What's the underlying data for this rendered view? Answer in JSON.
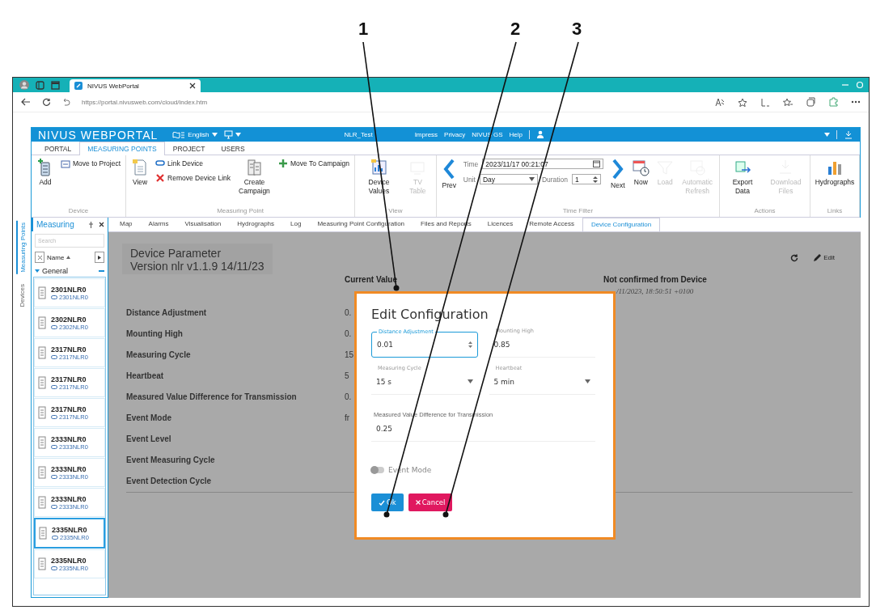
{
  "callouts": [
    "1",
    "2",
    "3"
  ],
  "browser": {
    "tab_title": "NIVUS WebPortal",
    "url": "https://portal.nivusweb.com/cloud/index.htm"
  },
  "header": {
    "brand": "NIVUS WEBPORTAL",
    "language": "English",
    "project": "NLR_Test",
    "links": [
      "Impress",
      "Privacy",
      "NIVUS GS",
      "Help"
    ]
  },
  "ribbon": {
    "tabs": [
      {
        "label": "PORTAL",
        "selected": false
      },
      {
        "label": "MEASURING POINTS",
        "selected": true
      },
      {
        "label": "PROJECT",
        "selected": false
      },
      {
        "label": "USERS",
        "selected": false
      }
    ],
    "groups": [
      {
        "title": "Device",
        "columns": [
          [
            {
              "kind": "large",
              "label": "Add",
              "disabled": false
            }
          ],
          [
            {
              "kind": "small",
              "label": "Move to Project",
              "disabled": false
            }
          ]
        ]
      },
      {
        "title": "Measuring Point",
        "columns": [
          [
            {
              "kind": "large",
              "label": "View",
              "disabled": false
            }
          ],
          [
            {
              "kind": "small",
              "label": "Link Device",
              "disabled": false
            },
            {
              "kind": "small",
              "label": "Remove Device Link",
              "disabled": false
            }
          ],
          [
            {
              "kind": "large",
              "label": "Create Campaign",
              "disabled": false
            }
          ],
          [
            {
              "kind": "small",
              "label": "Move To Campaign",
              "disabled": false
            }
          ]
        ]
      },
      {
        "title": "View",
        "columns": [
          [
            {
              "kind": "large",
              "label": "Device Values",
              "disabled": false
            }
          ],
          [
            {
              "kind": "large",
              "label": "TV Table",
              "disabled": true
            }
          ]
        ]
      },
      {
        "title": "Time Filter",
        "columns": [
          [
            {
              "kind": "nav",
              "label": "Prev",
              "disabled": false
            }
          ],
          [
            {
              "kind": "fields",
              "fields": [
                {
                  "kind": "date",
                  "label": "Time",
                  "value": "2023/11/17 00:21:07"
                }
              ]
            },
            {
              "kind": "fields",
              "fields": [
                {
                  "kind": "select",
                  "label": "Unit",
                  "value": "Day"
                },
                {
                  "kind": "spin",
                  "label": "Duration",
                  "value": "1"
                }
              ]
            }
          ],
          [
            {
              "kind": "nav",
              "label": "Next",
              "disabled": false
            }
          ],
          [
            {
              "kind": "large",
              "label": "Now",
              "disabled": false
            }
          ],
          [
            {
              "kind": "large",
              "label": "Load",
              "disabled": true
            }
          ],
          [
            {
              "kind": "large",
              "label": "Automatic Refresh",
              "disabled": true
            }
          ]
        ]
      },
      {
        "title": "Actions",
        "columns": [
          [
            {
              "kind": "large",
              "label": "Export Data",
              "disabled": false
            }
          ],
          [
            {
              "kind": "large",
              "label": "Download Files",
              "disabled": true
            }
          ]
        ]
      },
      {
        "title": "Links",
        "columns": [
          [
            {
              "kind": "large",
              "label": "Hydrographs",
              "disabled": false
            }
          ]
        ]
      }
    ]
  },
  "sidebar": {
    "vertical_tabs": [
      {
        "label": "Measuring Points",
        "selected": true
      },
      {
        "label": "Devices",
        "selected": false
      }
    ],
    "title": "Measuring",
    "search": {
      "placeholder": "Search"
    },
    "sort": "Name",
    "group": {
      "label": "General",
      "expanded": true,
      "items": [
        {
          "name": "2301NLR0",
          "sub": "2301NLR0",
          "selected": false
        },
        {
          "name": "2302NLR0",
          "sub": "2302NLR0",
          "selected": false
        },
        {
          "name": "2317NLR0",
          "sub": "2317NLR0",
          "selected": false
        },
        {
          "name": "2317NLR0",
          "sub": "2317NLR0",
          "selected": false
        },
        {
          "name": "2317NLR0",
          "sub": "2317NLR0",
          "selected": false
        },
        {
          "name": "2333NLR0",
          "sub": "2333NLR0",
          "selected": false
        },
        {
          "name": "2333NLR0",
          "sub": "2333NLR0",
          "selected": false
        },
        {
          "name": "2333NLR0",
          "sub": "2333NLR0",
          "selected": false
        },
        {
          "name": "2335NLR0",
          "sub": "2335NLR0",
          "selected": true
        },
        {
          "name": "2335NLR0",
          "sub": "2335NLR0",
          "selected": false
        }
      ]
    }
  },
  "doc_tabs": [
    {
      "label": "Map",
      "selected": false
    },
    {
      "label": "Alarms",
      "selected": false
    },
    {
      "label": "Visualisation",
      "selected": false
    },
    {
      "label": "Hydrographs",
      "selected": false
    },
    {
      "label": "Log",
      "selected": false
    },
    {
      "label": "Measuring Point Configuration",
      "selected": false
    },
    {
      "label": "Files and Reports",
      "selected": false
    },
    {
      "label": "Licences",
      "selected": false
    },
    {
      "label": "Remote Access",
      "selected": false
    },
    {
      "label": "Device Configuration",
      "selected": true
    }
  ],
  "device": {
    "title": "Device Parameter",
    "version": "Version nlr v1.1.9 14/11/23",
    "edit": "Edit",
    "columns": [
      "Current Value",
      "Not confirmed from Device"
    ],
    "timestamp": "/11/2023, 18:50:51 +0100",
    "parameters": [
      {
        "label": "Distance Adjustment",
        "current": "0."
      },
      {
        "label": "Mounting High",
        "current": "0."
      },
      {
        "label": "Measuring Cycle",
        "current": "15"
      },
      {
        "label": "Heartbeat",
        "current": "5"
      },
      {
        "label": "Measured Value Difference for Transmission",
        "current": "0."
      },
      {
        "label": "Event Mode",
        "current": "fr"
      },
      {
        "label": "Event Level"
      },
      {
        "label": "Event Measuring Cycle"
      },
      {
        "label": "Event Detection Cycle"
      }
    ]
  },
  "dialog": {
    "title": "Edit Configuration",
    "fields": [
      {
        "kind": "number",
        "label": "Distance Adjustment",
        "value": "0.01",
        "focused": true
      },
      {
        "kind": "text",
        "label": "Mounting High",
        "value": "0.85",
        "focused": false
      },
      {
        "kind": "select",
        "label": "Measuring Cycle",
        "value": "15 s",
        "focused": false
      },
      {
        "kind": "select",
        "label": "Heartbeat",
        "value": "5 min",
        "focused": false
      },
      {
        "kind": "text",
        "label": "Measured Value Difference for Transmission",
        "value": "0.25",
        "focused": false
      }
    ],
    "toggle": {
      "label": "Event Mode",
      "on": false
    },
    "buttons": [
      {
        "kind": "ok",
        "label": "Ok"
      },
      {
        "kind": "cancel",
        "label": "Cancel"
      }
    ]
  }
}
